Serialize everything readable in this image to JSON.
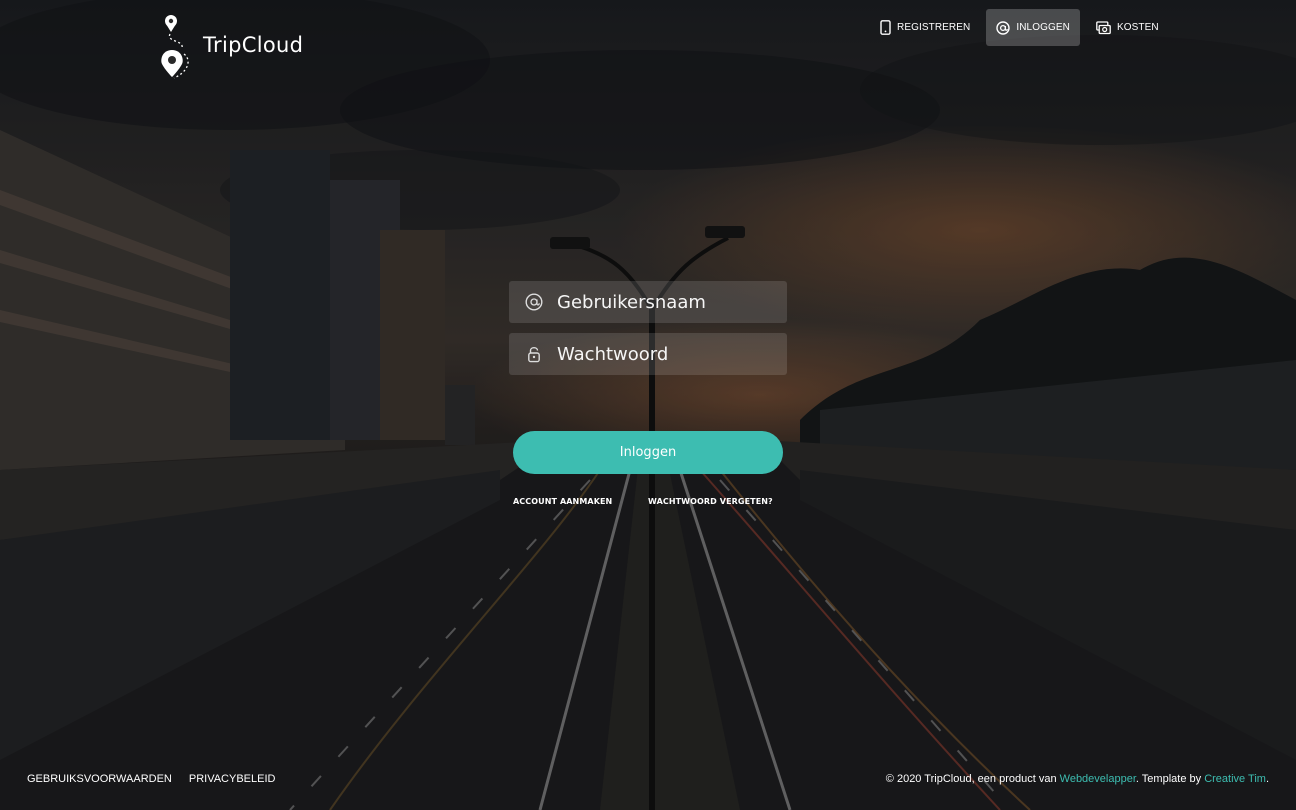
{
  "brand": {
    "name": "TripCloud",
    "logo_icon": "map-pin-route-icon"
  },
  "nav": {
    "items": [
      {
        "label": "REGISTREREN",
        "icon": "mobile-icon",
        "active": false
      },
      {
        "label": "INLOGGEN",
        "icon": "at-icon",
        "active": true
      },
      {
        "label": "KOSTEN",
        "icon": "money-icon",
        "active": false
      }
    ]
  },
  "login": {
    "username_placeholder": "Gebruikersnaam",
    "username_icon": "at-icon",
    "password_placeholder": "Wachtwoord",
    "password_icon": "lock-icon",
    "submit_label": "Inloggen",
    "create_account_label": "ACCOUNT AANMAKEN",
    "forgot_password_label": "WACHTWOORD VERGETEN?"
  },
  "footer": {
    "terms_label": "GEBRUIKSVOORWAARDEN",
    "privacy_label": "PRIVACYBELEID",
    "copyright_prefix": "© 2020 TripCloud, een product van",
    "company_link": "Webdevelapper",
    "template_prefix": ". Template by",
    "template_link": "Creative Tim",
    "suffix": "."
  },
  "colors": {
    "accent": "#3dbdb1",
    "background_dark": "#1b1b1c",
    "sunset": "#a05e34"
  }
}
